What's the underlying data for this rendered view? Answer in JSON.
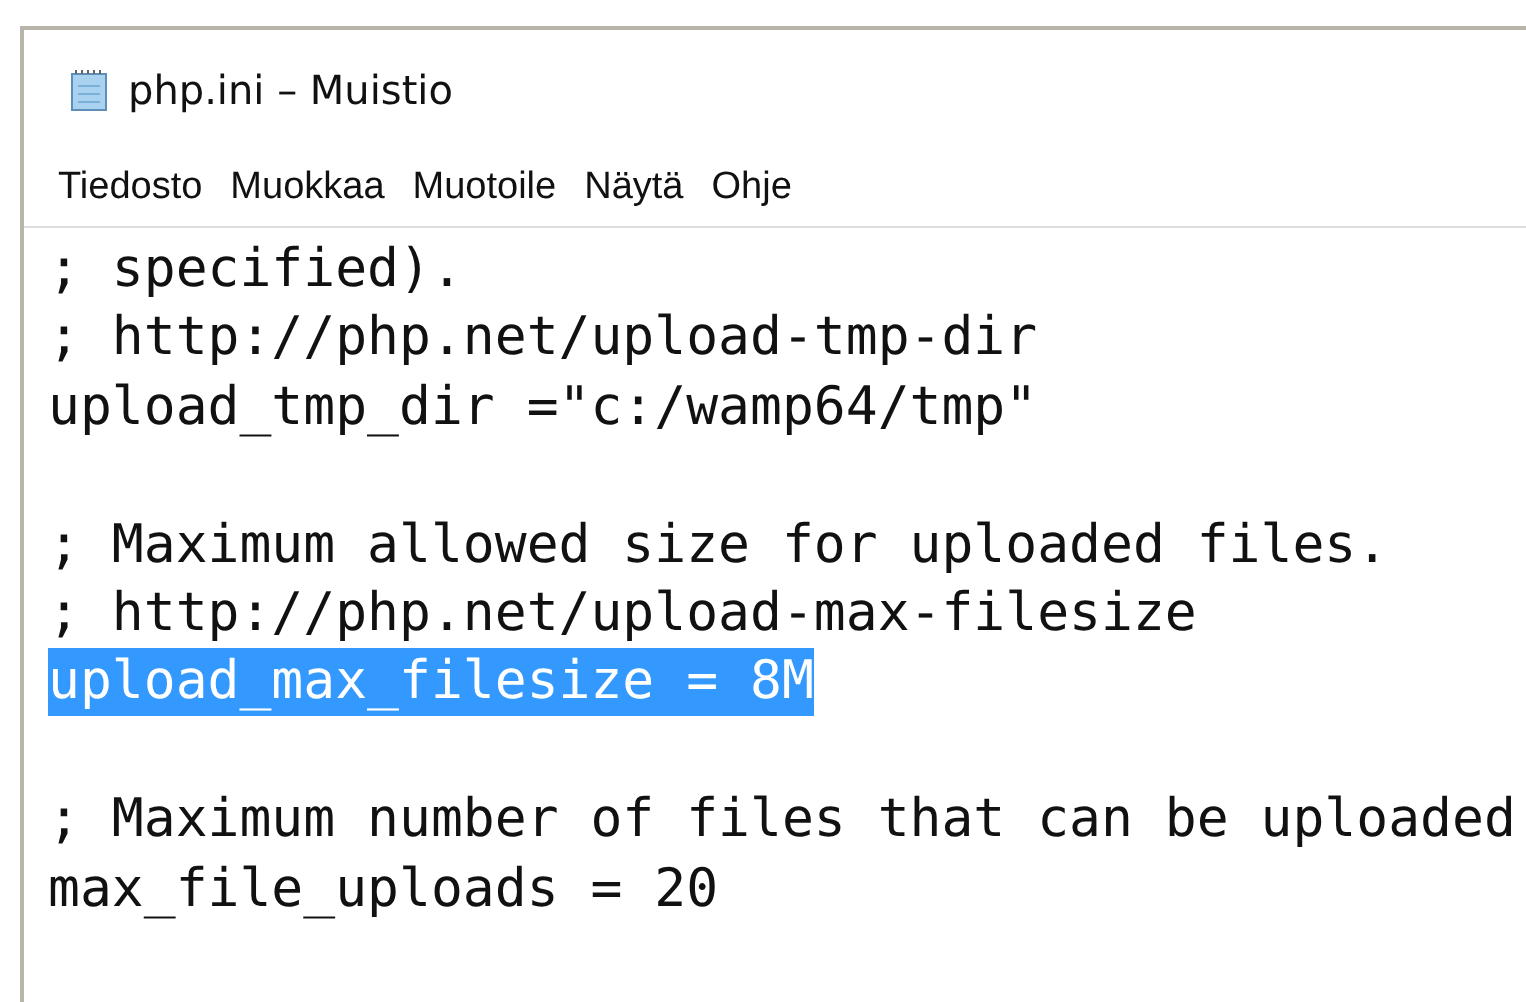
{
  "window": {
    "title": "php.ini – Muistio"
  },
  "menu": [
    "Tiedosto",
    "Muokkaa",
    "Muotoile",
    "Näytä",
    "Ohje"
  ],
  "editor": {
    "lines": [
      {
        "kind": "text",
        "text": "; specified).",
        "selected": false
      },
      {
        "kind": "text",
        "text": "; http://php.net/upload-tmp-dir",
        "selected": false
      },
      {
        "kind": "text",
        "text": "upload_tmp_dir =\"c:/wamp64/tmp\"",
        "selected": false
      },
      {
        "kind": "blank"
      },
      {
        "kind": "text",
        "text": "; Maximum allowed size for uploaded files.",
        "selected": false
      },
      {
        "kind": "text",
        "text": "; http://php.net/upload-max-filesize",
        "selected": false
      },
      {
        "kind": "text",
        "text": "upload_max_filesize = 8M",
        "selected": true
      },
      {
        "kind": "blank"
      },
      {
        "kind": "text",
        "text": "; Maximum number of files that can be uploaded",
        "selected": false
      },
      {
        "kind": "text",
        "text": "max_file_uploads = 20",
        "selected": false
      }
    ]
  }
}
